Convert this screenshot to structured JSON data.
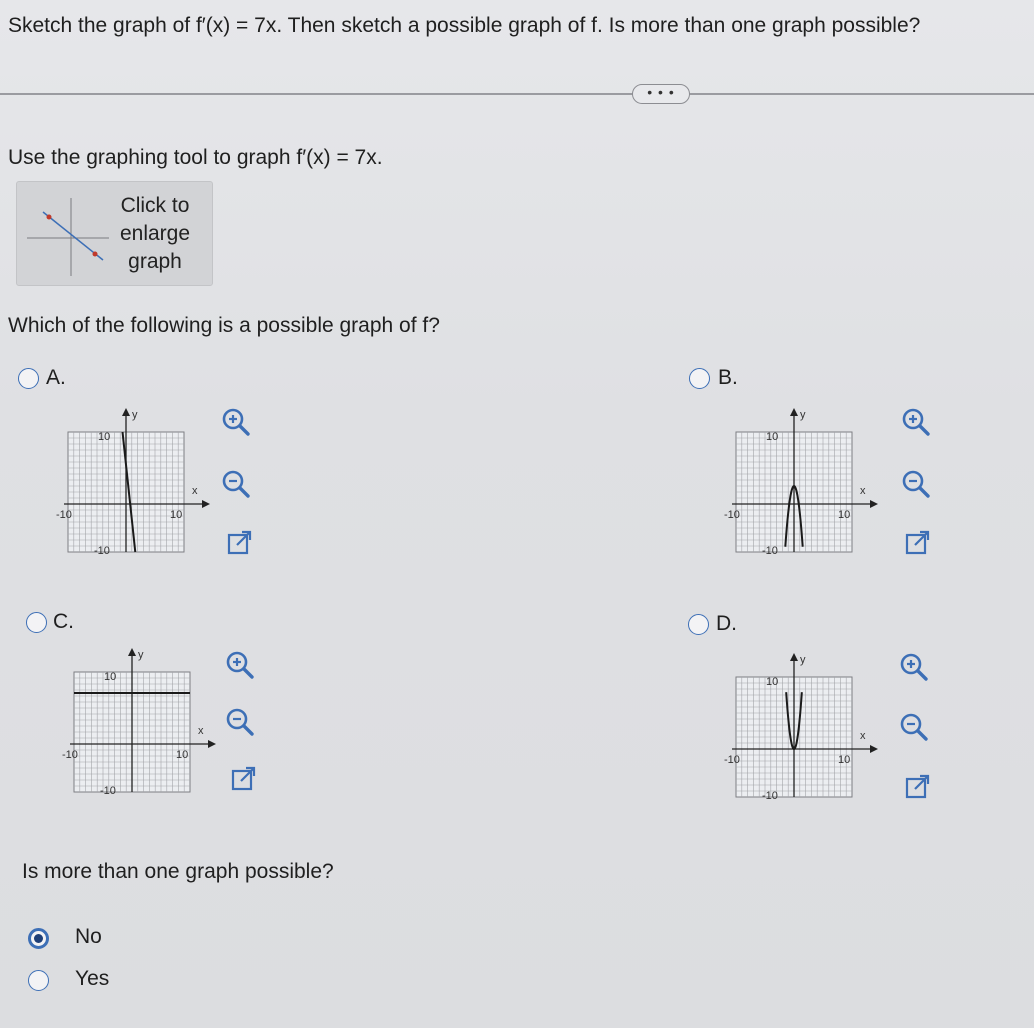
{
  "question": {
    "main": "Sketch the graph of f′(x) = 7x. Then sketch a possible graph of f. Is more than one graph possible?",
    "more_label": "• • •",
    "tool_instruction": "Use the graphing tool to graph f′(x) = 7x.",
    "enlarge_lines": [
      "Click to",
      "enlarge",
      "graph"
    ],
    "which_prompt": "Which of the following is a possible graph of f?",
    "multiple_prompt": "Is more than one graph possible?"
  },
  "options": [
    {
      "letter": "A.",
      "shape": "steep decreasing line",
      "axis": {
        "y": "y",
        "x": "x",
        "top": "10",
        "bottom": "-10",
        "left": "-10",
        "right": "10"
      }
    },
    {
      "letter": "B.",
      "shape": "downward parabola",
      "axis": {
        "y": "y",
        "x": "x",
        "top": "10",
        "bottom": "-10",
        "left": "-10",
        "right": "10"
      }
    },
    {
      "letter": "C.",
      "shape": "horizontal line",
      "axis": {
        "y": "y",
        "x": "x",
        "top": "10",
        "bottom": "-10",
        "left": "-10",
        "right": "10"
      }
    },
    {
      "letter": "D.",
      "shape": "upward parabola",
      "axis": {
        "y": "y",
        "x": "x",
        "top": "10",
        "bottom": "-10",
        "left": "-10",
        "right": "10"
      }
    }
  ],
  "answers": [
    {
      "label": "No",
      "selected": true
    },
    {
      "label": "Yes",
      "selected": false
    }
  ],
  "icons": [
    "zoom-in-icon",
    "zoom-out-icon",
    "open-external-icon"
  ],
  "colors": {
    "accent": "#3d6fb6",
    "grid": "#8a8b90",
    "curve": "#1a1a1a"
  }
}
